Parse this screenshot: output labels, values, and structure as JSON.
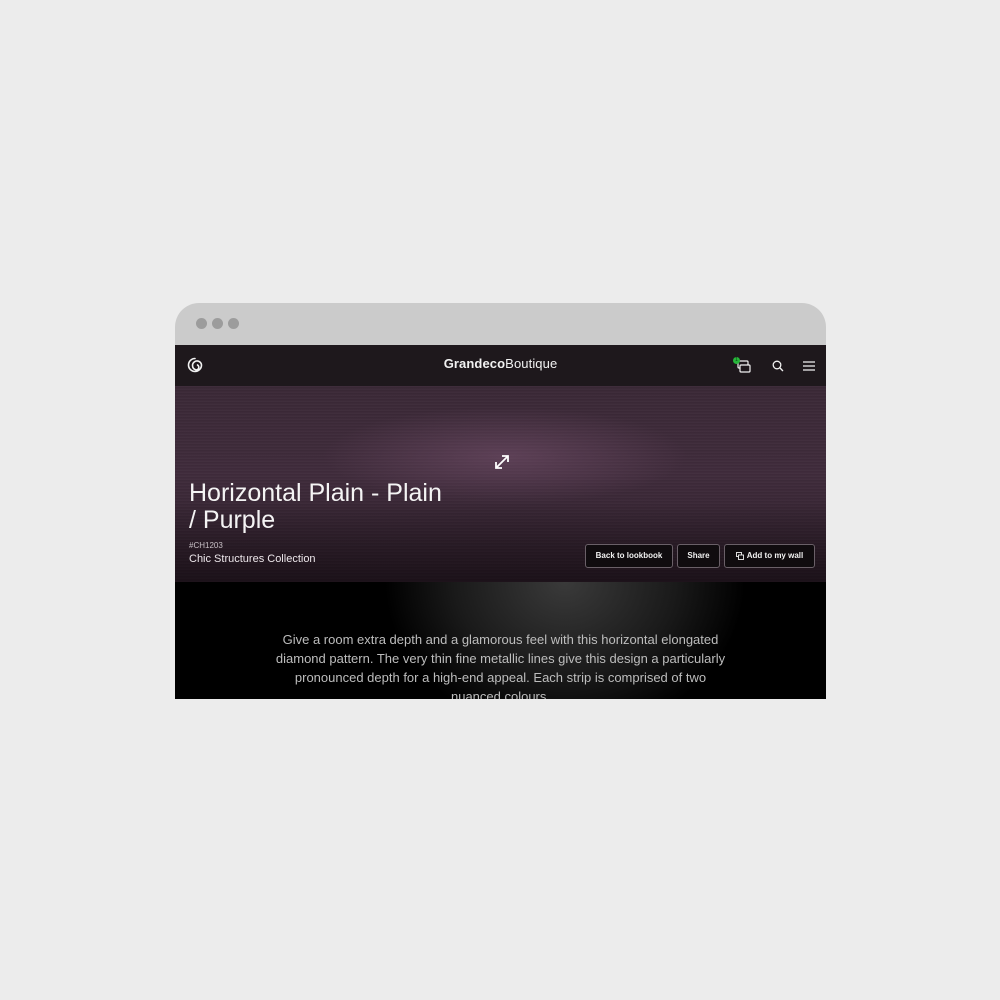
{
  "window": {
    "controls": [
      "close",
      "minimize",
      "maximize"
    ]
  },
  "navbar": {
    "logo_icon": "spiral-logo-icon",
    "brand_primary": "Grandeco",
    "brand_secondary": "Boutique",
    "wall_badge_count": "1",
    "icons": [
      "wall-samples-icon",
      "search-icon",
      "menu-icon"
    ]
  },
  "hero": {
    "expand_icon": "expand-arrows-icon",
    "title": "Horizontal Plain - Plain / Purple",
    "code": "#CH1203",
    "collection": "Chic Structures Collection",
    "buttons": {
      "back": "Back to lookbook",
      "share": "Share",
      "add_to_wall": "Add to my wall"
    }
  },
  "description": {
    "text": "Give a room extra depth and a glamorous feel with this horizontal elongated diamond pattern. The very thin fine metallic lines give this design a particularly pronounced depth for a high-end appeal. Each strip is comprised of two nuanced colours."
  },
  "colors": {
    "page_bg": "#ececec",
    "chrome_bg": "#cbcbcb",
    "navbar_bg": "#1e181c",
    "hero_purple": "#3f2b3b",
    "badge_green": "#27b53a"
  }
}
